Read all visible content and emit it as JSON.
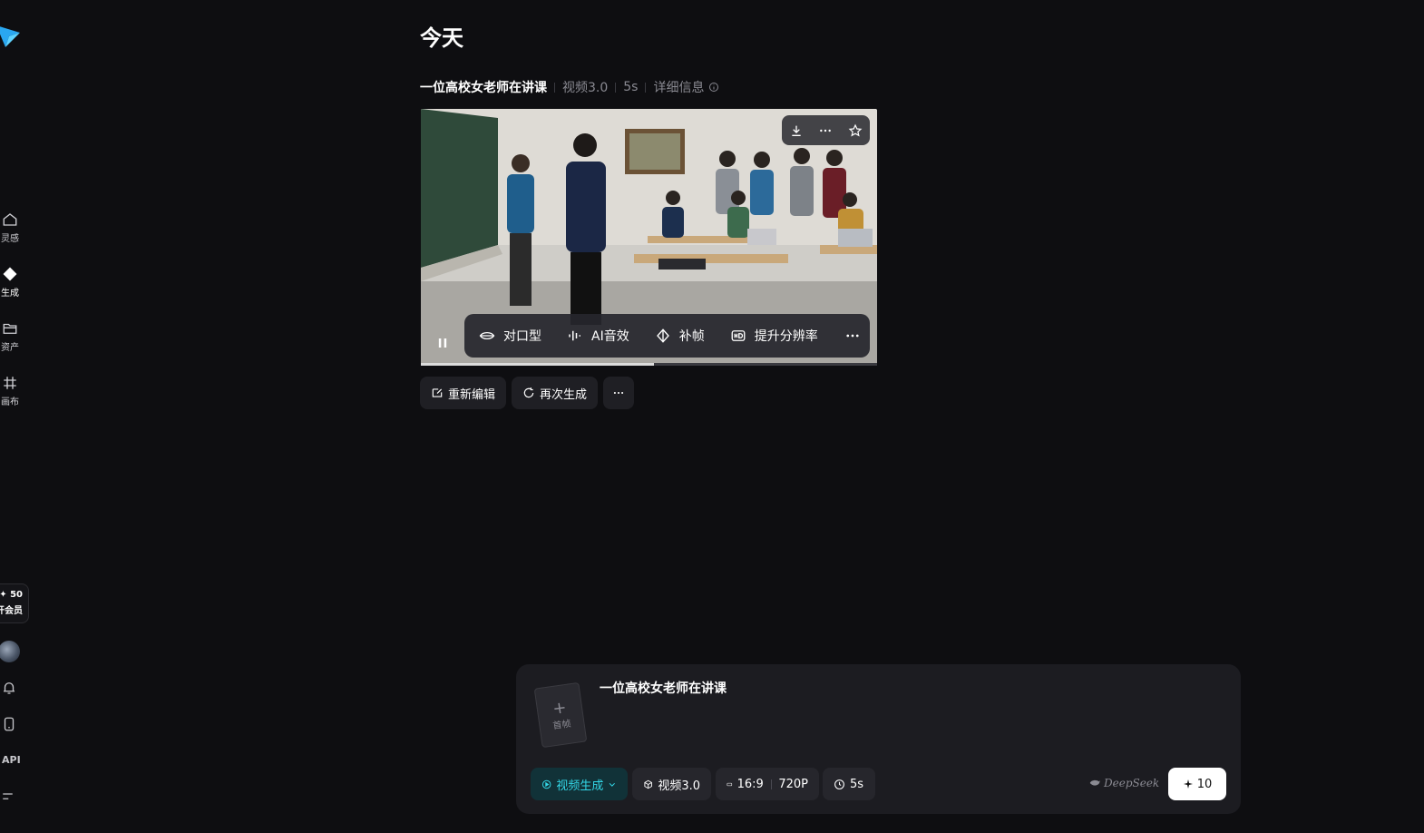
{
  "sidebar": {
    "items": [
      {
        "label": "灵感",
        "icon": "home-icon"
      },
      {
        "label": "生成",
        "icon": "sparkle-diamond-icon",
        "active": true
      },
      {
        "label": "资产",
        "icon": "folder-icon"
      },
      {
        "label": "画布",
        "icon": "canvas-grid-icon"
      }
    ],
    "credits": "✦ 50",
    "membership": "开会员",
    "api_label": "API"
  },
  "main": {
    "day_title": "今天",
    "generation": {
      "prompt": "一位高校女老师在讲课",
      "model": "视频3.0",
      "duration": "5s",
      "details_label": "详细信息",
      "progress": 0.51
    },
    "video_tools": [
      {
        "label": "对口型",
        "icon": "lip-sync-icon"
      },
      {
        "label": "AI音效",
        "icon": "sound-wave-icon"
      },
      {
        "label": "补帧",
        "icon": "frame-interpolation-icon"
      },
      {
        "label": "提升分辨率",
        "icon": "hd-icon"
      }
    ],
    "actions": {
      "reedit": "重新编辑",
      "regenerate": "再次生成"
    }
  },
  "composer": {
    "prompt_text": "一位高校女老师在讲课",
    "first_frame_label": "首帧",
    "mode": "视频生成",
    "model": "视频3.0",
    "ratio": "16:9",
    "resolution": "720P",
    "duration": "5s",
    "provider": "DeepSeek",
    "send_cost": "10",
    "accent_color": "#33d6e6"
  }
}
